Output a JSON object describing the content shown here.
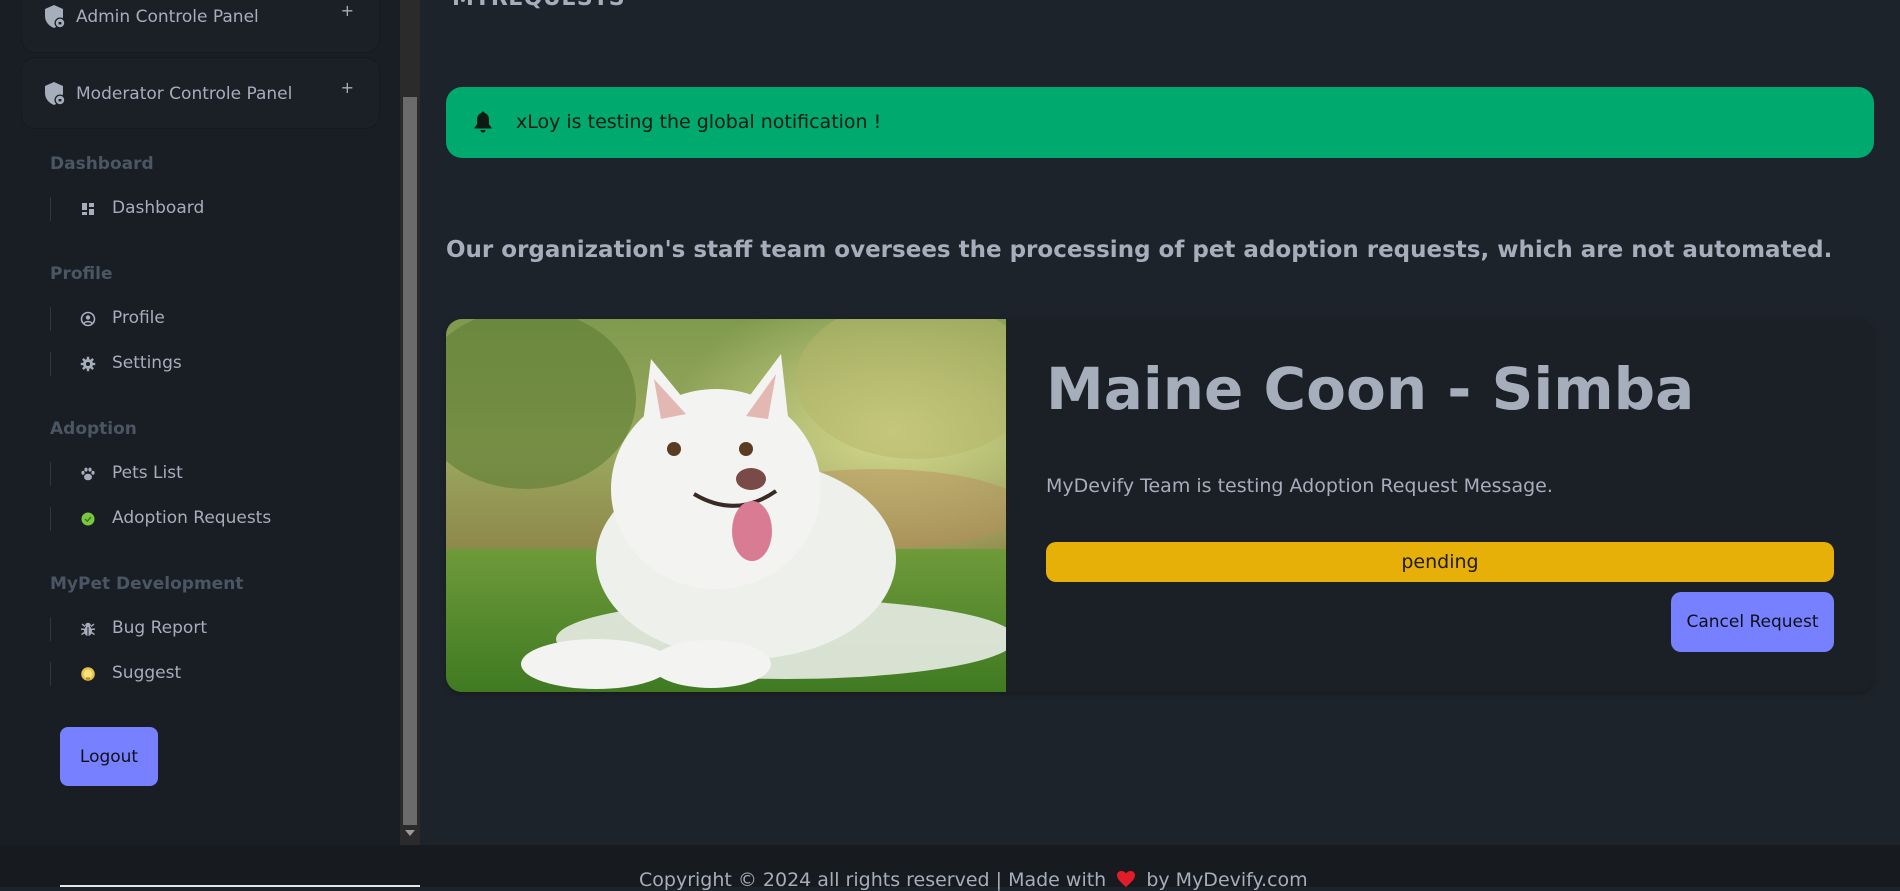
{
  "sidebar": {
    "panels": {
      "admin": {
        "title": "Admin Controle Panel",
        "toggle": "+"
      },
      "moderator": {
        "title": "Moderator Controle Panel",
        "toggle": "+"
      }
    },
    "sections": {
      "dashboard": {
        "title": "Dashboard",
        "items": [
          {
            "label": "Dashboard",
            "icon": "dashboard-icon"
          }
        ]
      },
      "profile": {
        "title": "Profile",
        "items": [
          {
            "label": "Profile",
            "icon": "user-circle-icon"
          },
          {
            "label": "Settings",
            "icon": "gear-icon"
          }
        ]
      },
      "adoption": {
        "title": "Adoption",
        "items": [
          {
            "label": "Pets List",
            "icon": "paw-icon"
          },
          {
            "label": "Adoption Requests",
            "icon": "green-dot-icon"
          }
        ]
      },
      "development": {
        "title": "MyPet Development",
        "items": [
          {
            "label": "Bug Report",
            "icon": "bug-icon"
          },
          {
            "label": "Suggest",
            "icon": "lightbulb-icon"
          }
        ]
      }
    },
    "logout_label": "Logout"
  },
  "main": {
    "page_title": "MYREQUESTS",
    "notification": {
      "text": "xLoy is testing the global notification !",
      "color": "#00a96e"
    },
    "intro": "Our organization's staff team oversees the processing of pet adoption requests, which are not automated.",
    "request": {
      "pet_name": "Maine Coon - Simba",
      "message": "MyDevify Team is testing Adoption Request Message.",
      "status": "pending",
      "status_color": "#e7b008",
      "cancel_label": "Cancel Request"
    }
  },
  "footer": {
    "text_before": "Copyright © 2024 all rights reserved | Made with",
    "text_after": "by MyDevify.com"
  },
  "colors": {
    "accent": "#7780ff",
    "background": "#1d232a",
    "sidebar": "#191e24"
  }
}
